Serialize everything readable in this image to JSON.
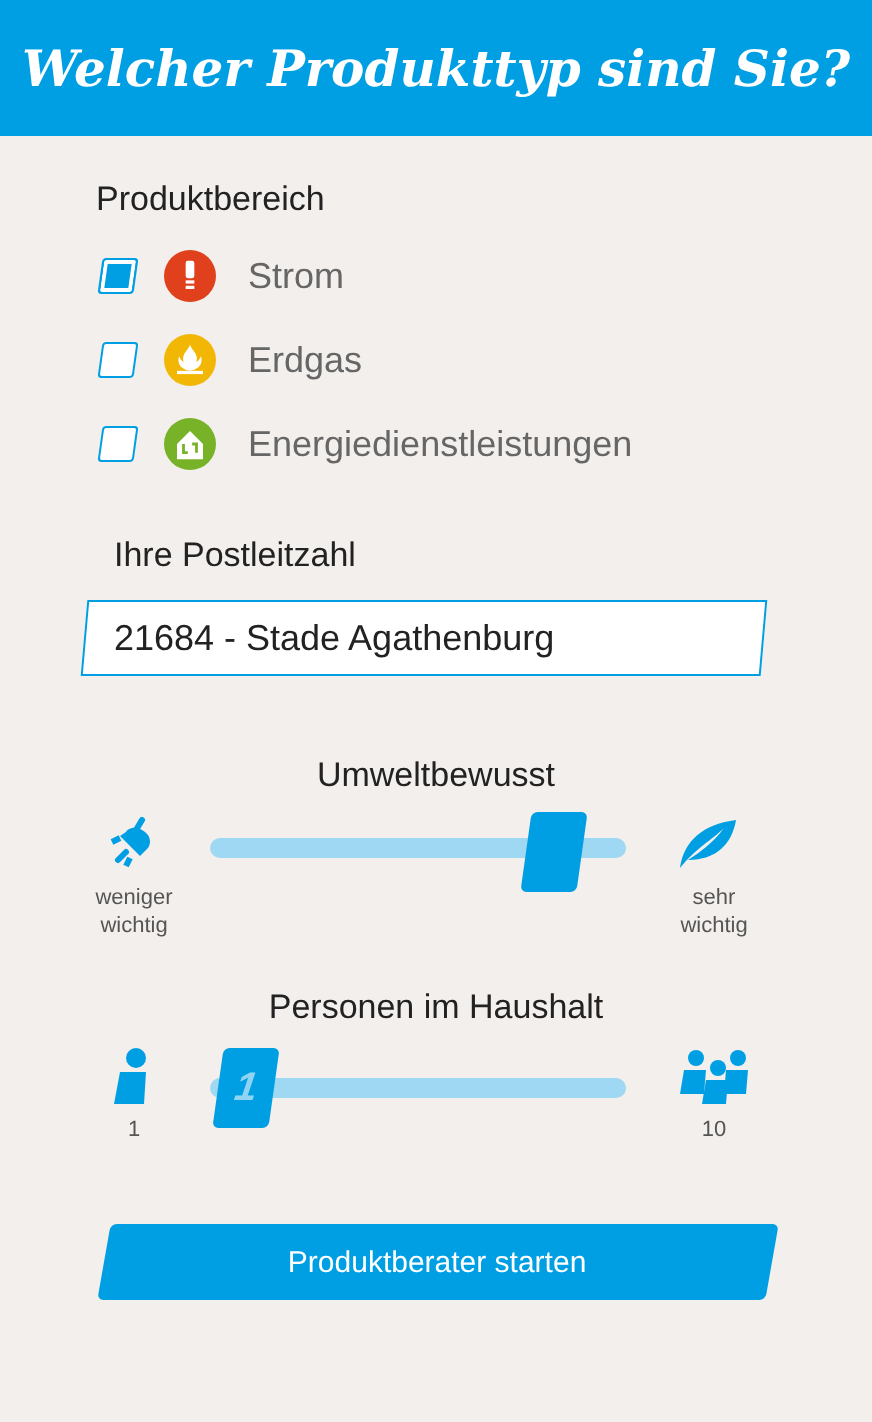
{
  "header": {
    "title": "Welcher Produkttyp sind Sie?"
  },
  "product_area": {
    "label": "Produktbereich",
    "options": [
      {
        "label": "Strom",
        "checked": true,
        "color": "#e0401c",
        "kind": "bulb"
      },
      {
        "label": "Erdgas",
        "checked": false,
        "color": "#f2b705",
        "kind": "flame"
      },
      {
        "label": "Energiedienstleistungen",
        "checked": false,
        "color": "#78b228",
        "kind": "house"
      }
    ]
  },
  "postcode": {
    "label": "Ihre Postleitzahl",
    "value": "21684 - Stade Agathenburg"
  },
  "sliders": [
    {
      "title": "Umweltbewusst",
      "level": 0.88,
      "min_label": "weniger wichtig",
      "max_label": "sehr wichtig",
      "kind": "environment"
    },
    {
      "title": "Personen im Haushalt",
      "level": 0.02,
      "thumb_label": "1",
      "min_label": "1",
      "max_label": "10",
      "kind": "household"
    }
  ],
  "submit": {
    "label": "Produktberater starten"
  }
}
